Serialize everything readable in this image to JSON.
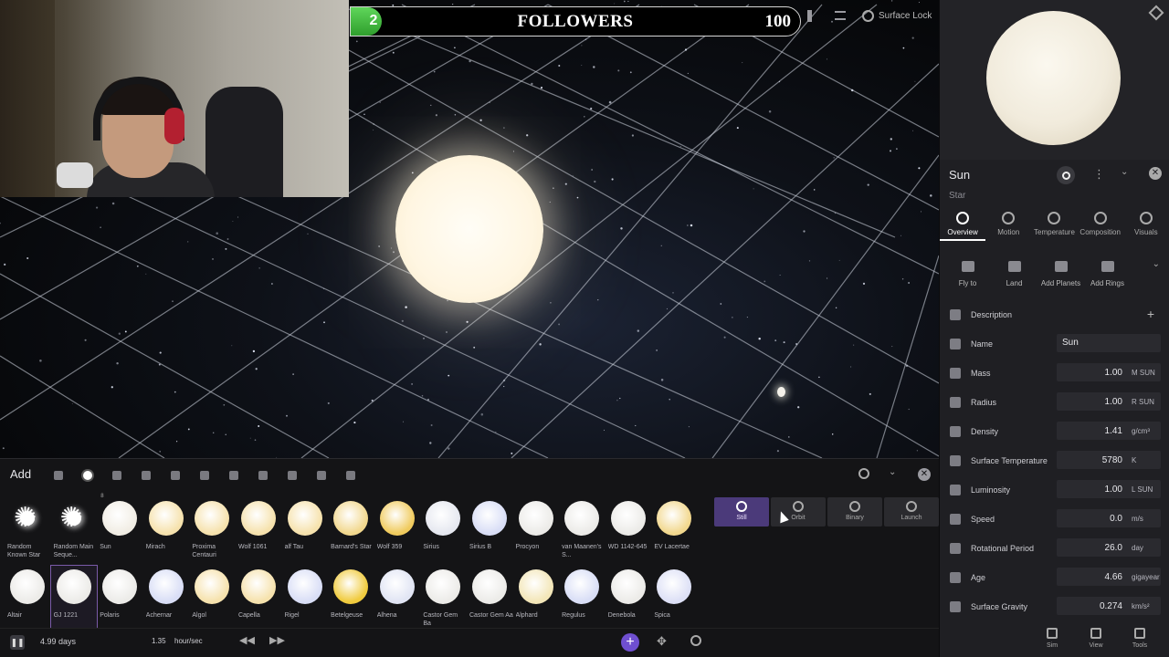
{
  "followers": {
    "title": "FOLLOWERS",
    "current": "2",
    "goal": "100",
    "progress": 0.07
  },
  "top_tools": {
    "surface_lock": "Surface Lock"
  },
  "object": {
    "name": "Sun",
    "type": "Star"
  },
  "tabs": [
    {
      "label": "Overview",
      "icon": "ring-icon",
      "active": true
    },
    {
      "label": "Motion",
      "icon": "motion-icon",
      "active": false
    },
    {
      "label": "Temperature",
      "icon": "thermometer-icon",
      "active": false
    },
    {
      "label": "Composition",
      "icon": "composition-icon",
      "active": false
    },
    {
      "label": "Visuals",
      "icon": "palette-icon",
      "active": false
    }
  ],
  "actions": [
    {
      "label": "Fly to",
      "icon": "plane-icon"
    },
    {
      "label": "Land",
      "icon": "landing-icon"
    },
    {
      "label": "Add Planets",
      "icon": "add-planet-icon"
    },
    {
      "label": "Add Rings",
      "icon": "add-rings-icon"
    }
  ],
  "props": {
    "description": {
      "label": "Description"
    },
    "name": {
      "label": "Name",
      "value": "Sun"
    },
    "mass": {
      "label": "Mass",
      "value": "1.00",
      "unit": "M SUN"
    },
    "radius": {
      "label": "Radius",
      "value": "1.00",
      "unit": "R SUN"
    },
    "density": {
      "label": "Density",
      "value": "1.41",
      "unit": "g/cm³"
    },
    "surface_temperature": {
      "label": "Surface Temperature",
      "value": "5780",
      "unit": "K"
    },
    "luminosity": {
      "label": "Luminosity",
      "value": "1.00",
      "unit": "L SUN"
    },
    "speed": {
      "label": "Speed",
      "value": "0.0",
      "unit": "m/s"
    },
    "rotational_period": {
      "label": "Rotational Period",
      "value": "26.0",
      "unit": "day"
    },
    "age": {
      "label": "Age",
      "value": "4.66",
      "unit": "gigayear"
    },
    "surface_gravity": {
      "label": "Surface Gravity",
      "value": "0.274",
      "unit": "km/s²"
    }
  },
  "bottom_nav": [
    {
      "label": "Sim",
      "icon": "cube-icon"
    },
    {
      "label": "View",
      "icon": "layers-icon"
    },
    {
      "label": "Tools",
      "icon": "wrench-icon"
    }
  ],
  "add_panel": {
    "title": "Add",
    "first_row_count": "8",
    "stars": [
      {
        "label": "Random Known Star",
        "color": "burst"
      },
      {
        "label": "Random Main Seque...",
        "color": "burst"
      },
      {
        "label": "Sun",
        "color": "#f1ede4"
      },
      {
        "label": "Mirach",
        "color": "#f6e2ad"
      },
      {
        "label": "Proxima Centauri",
        "color": "#f6e2ad"
      },
      {
        "label": "Wolf 1061",
        "color": "#f6e2ad"
      },
      {
        "label": "alf Tau",
        "color": "#f6e2ad"
      },
      {
        "label": "Barnard's Star",
        "color": "#f2d88e"
      },
      {
        "label": "Wolf 359",
        "color": "#f0cb5e"
      },
      {
        "label": "Sirius",
        "color": "#e6e8f0"
      },
      {
        "label": "Sirius B",
        "color": "#d9def6"
      },
      {
        "label": "Procyon",
        "color": "#ecebe8"
      },
      {
        "label": "van Maanen's S...",
        "color": "#ecebe8"
      },
      {
        "label": "WD 1142-645",
        "color": "#ecebe8"
      },
      {
        "label": "EV Lacertae",
        "color": "#f2d88e"
      },
      {
        "label": "Altair",
        "color": "#ecebe8"
      },
      {
        "label": "GJ 1221",
        "color": "#ecebe8"
      },
      {
        "label": "Polaris",
        "color": "#ecebe8"
      },
      {
        "label": "Achernar",
        "color": "#d9def6"
      },
      {
        "label": "Algol",
        "color": "#f6e2ad"
      },
      {
        "label": "Capella",
        "color": "#f6e2ad"
      },
      {
        "label": "Rigel",
        "color": "#d9def6"
      },
      {
        "label": "Betelgeuse",
        "color": "#f0cb3e"
      },
      {
        "label": "Alhena",
        "color": "#e1e5f4"
      },
      {
        "label": "Castor Gem Ba",
        "color": "#ecebe8"
      },
      {
        "label": "Castor Gem Aa",
        "color": "#ecebe8"
      },
      {
        "label": "Alphard",
        "color": "#f3e6b8"
      },
      {
        "label": "Regulus",
        "color": "#d9def6"
      },
      {
        "label": "Denebola",
        "color": "#ecebe8"
      },
      {
        "label": "Spica",
        "color": "#dde0f6"
      }
    ],
    "modes": [
      {
        "label": "Still",
        "icon": "still-icon",
        "active": true
      },
      {
        "label": "Orbit",
        "icon": "orbit-icon",
        "active": false
      },
      {
        "label": "Binary",
        "icon": "binary-icon",
        "active": false
      },
      {
        "label": "Launch",
        "icon": "launch-icon",
        "active": false
      }
    ]
  },
  "time_bar": {
    "sim_time": "4.99 days",
    "rate_value": "1.35",
    "rate_unit": "hour/sec"
  }
}
